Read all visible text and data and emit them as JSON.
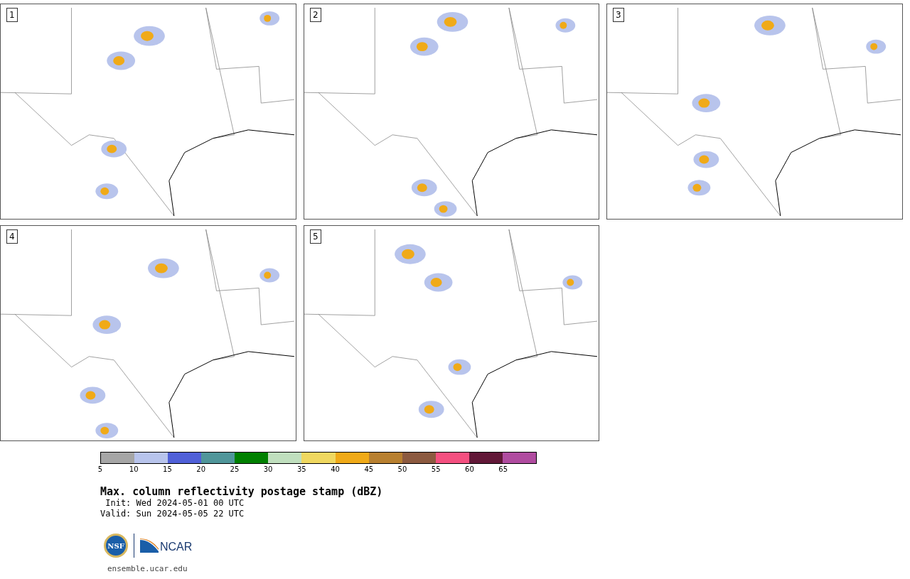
{
  "panels": [
    {
      "label": "1"
    },
    {
      "label": "2"
    },
    {
      "label": "3"
    },
    {
      "label": "4"
    },
    {
      "label": "5"
    }
  ],
  "colorbar": {
    "bins": [
      {
        "color": "#a6a6a6"
      },
      {
        "color": "#b8c4ec"
      },
      {
        "color": "#5060d8"
      },
      {
        "color": "#50969a"
      },
      {
        "color": "#008000"
      },
      {
        "color": "#c0dfbe"
      },
      {
        "color": "#f0d860"
      },
      {
        "color": "#f0aa18"
      },
      {
        "color": "#b88030"
      },
      {
        "color": "#8c5a40"
      },
      {
        "color": "#f45080"
      },
      {
        "color": "#621838"
      },
      {
        "color": "#b04ca0"
      }
    ],
    "ticks": [
      "5",
      "10",
      "15",
      "20",
      "25",
      "30",
      "35",
      "40",
      "45",
      "50",
      "55",
      "60",
      "65"
    ]
  },
  "title": "Max. column reflectivity postage stamp (dBZ)",
  "init": " Init: Wed 2024-05-01 00 UTC",
  "valid": "Valid: Sun 2024-05-05 22 UTC",
  "logos": {
    "left": "NSF",
    "right": "NCAR"
  },
  "url": "ensemble.ucar.edu"
}
